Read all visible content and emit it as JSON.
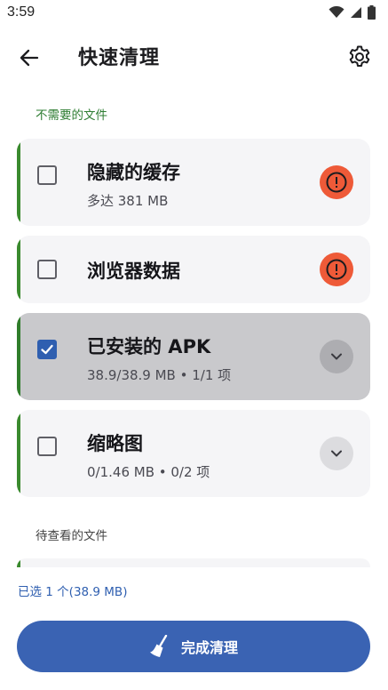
{
  "status_bar": {
    "time": "3:59"
  },
  "app_bar": {
    "title": "快速清理"
  },
  "sections": [
    {
      "label": "不需要的文件"
    },
    {
      "label": "待查看的文件"
    }
  ],
  "items": [
    {
      "title": "隐藏的缓存",
      "subtitle": "多达 381 MB",
      "checked": false,
      "action_icon": "warning-icon"
    },
    {
      "title": "浏览器数据",
      "subtitle": "",
      "checked": false,
      "action_icon": "warning-icon"
    },
    {
      "title": "已安装的 APK",
      "subtitle": "38.9/38.9 MB • 1/1 项",
      "checked": true,
      "action_icon": "chevron-down-icon"
    },
    {
      "title": "缩略图",
      "subtitle": "0/1.46 MB • 0/2 项",
      "checked": false,
      "action_icon": "chevron-down-icon"
    }
  ],
  "footer": {
    "selected_summary": "已选 1 个(38.9 MB)",
    "primary_button_label": "完成清理",
    "primary_button_icon": "broom-icon"
  },
  "colors": {
    "accent_green": "#3a8a2e",
    "primary_blue": "#3a63b3",
    "warning_orange": "#ee5a38"
  }
}
